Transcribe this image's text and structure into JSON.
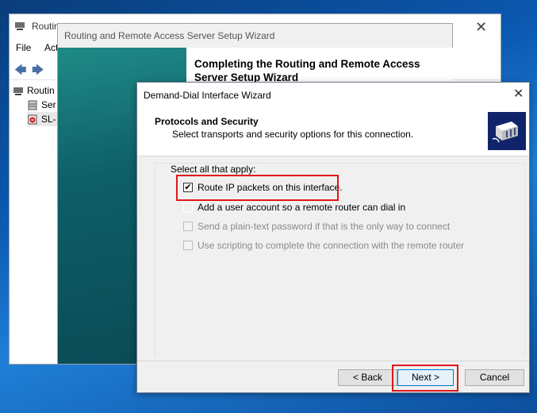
{
  "mmc": {
    "title": "Routin",
    "menu": [
      "File",
      "Act"
    ],
    "tree": [
      {
        "label": "Routin",
        "icon": "router-icon"
      },
      {
        "label": "Ser",
        "icon": "server-icon"
      },
      {
        "label": "SL-",
        "icon": "server-down-icon"
      }
    ]
  },
  "setup_wizard": {
    "title": "Routing and Remote Access Server Setup Wizard",
    "headline": "Completing the Routing and Remote Access Server Setup Wizard"
  },
  "dialog": {
    "title": "Demand-Dial Interface Wizard",
    "header_title": "Protocols and Security",
    "header_subtitle": "Select transports and security options for this connection.",
    "select_label": "Select all that apply:",
    "options": [
      {
        "label": "Route IP packets on this interface.",
        "checked": true,
        "enabled": true
      },
      {
        "label": "Add a user account so a remote router can dial in",
        "checked": false,
        "enabled": true
      },
      {
        "label": "Send a plain-text password if that is the only way to connect",
        "checked": false,
        "enabled": false
      },
      {
        "label": "Use scripting to complete the connection with the remote router",
        "checked": false,
        "enabled": false
      }
    ],
    "buttons": {
      "back": "< Back",
      "next": "Next >",
      "cancel": "Cancel"
    }
  },
  "colors": {
    "highlight": "#e0161b",
    "accent": "#0078d7"
  }
}
